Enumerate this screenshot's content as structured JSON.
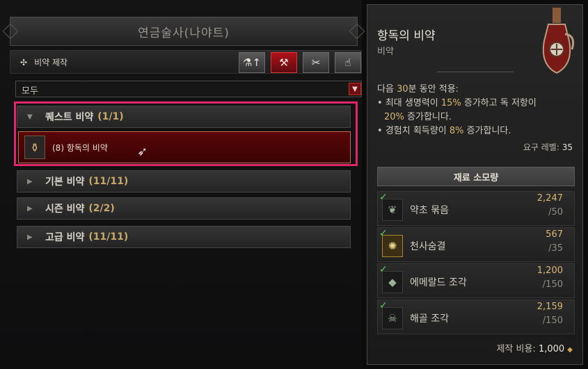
{
  "vendor": {
    "title": "연금술사(나야트)"
  },
  "toolbar": {
    "label": "비약 제작",
    "buttons": [
      {
        "icon": "flask-upgrade-icon",
        "glyph": "⚗"
      },
      {
        "icon": "craft-hammer-icon",
        "glyph": "⚒"
      },
      {
        "icon": "tools-icon",
        "glyph": "⚒"
      },
      {
        "icon": "hand-icon",
        "glyph": "✋"
      }
    ]
  },
  "filter": {
    "value": "모두"
  },
  "categories": [
    {
      "label": "퀘스트 비약",
      "count": "(1/1)",
      "expanded": true
    },
    {
      "label": "기본 비약",
      "count": "(11/11)",
      "expanded": false
    },
    {
      "label": "시즌 비약",
      "count": "(2/2)",
      "expanded": false
    },
    {
      "label": "고급 비약",
      "count": "(11/11)",
      "expanded": false
    }
  ],
  "selected_item": {
    "label": "(8) 항독의 비약"
  },
  "tooltip": {
    "title": "항독의 비약",
    "subtitle": "비약",
    "effect_line1_pre": "다음 ",
    "effect_line1_hl": "30",
    "effect_line1_post": "분 동안 적용:",
    "effect_line2_pre": "최대 생명력이 ",
    "effect_line2_hl": "15%",
    "effect_line2_post": " 증가하고 독 저항이",
    "effect_line3_hl": "20%",
    "effect_line3_post": " 증가합니다.",
    "effect_line4_pre": "경험치 획득량이 ",
    "effect_line4_hl": "8%",
    "effect_line4_post": " 증가합니다.",
    "req_label": "요구 레벨:",
    "req_value": "35",
    "materials_header": "재료 소모량",
    "materials": [
      {
        "name": "약초 묶음",
        "have": "2,247",
        "need": "/50",
        "icon": "herb-icon"
      },
      {
        "name": "천사숨결",
        "have": "567",
        "need": "/35",
        "icon": "angel-breath-icon"
      },
      {
        "name": "에메랄드 조각",
        "have": "1,200",
        "need": "/150",
        "icon": "emerald-icon"
      },
      {
        "name": "해골 조각",
        "have": "2,159",
        "need": "/150",
        "icon": "skull-icon"
      }
    ],
    "cost_label": "제작 비용:",
    "cost_value": "1,000"
  },
  "colors": {
    "accent_red": "#b1121a",
    "highlight_pink": "#e0256b",
    "gold": "#d9b772"
  }
}
